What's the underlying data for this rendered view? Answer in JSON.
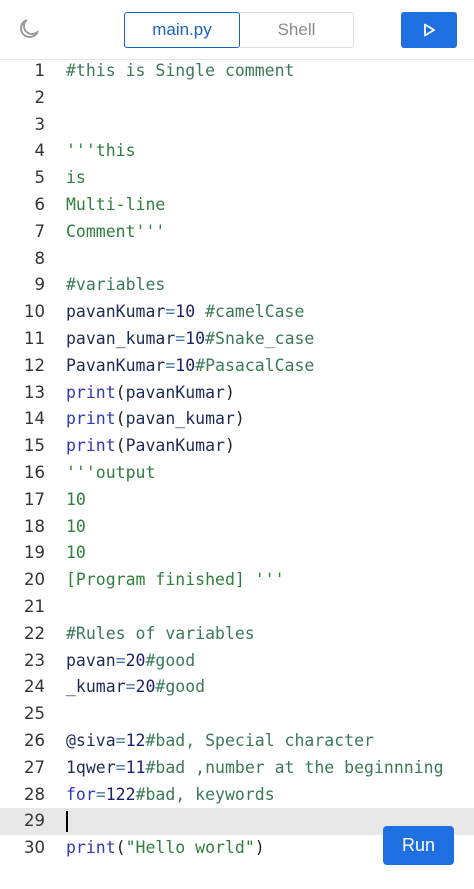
{
  "header": {
    "tab_main": "main.py",
    "tab_shell": "Shell"
  },
  "run_button_label": "Run",
  "icons": {
    "theme": "moon-icon",
    "run": "play-icon"
  },
  "colors": {
    "accent": "#1e6fe0",
    "comment": "#3a7a57",
    "keyword": "#3338b8"
  },
  "editor": {
    "active_line": 29,
    "lines": [
      {
        "n": "1"
      },
      {
        "n": "2"
      },
      {
        "n": "3"
      },
      {
        "n": "4"
      },
      {
        "n": "5"
      },
      {
        "n": "6"
      },
      {
        "n": "7"
      },
      {
        "n": "8"
      },
      {
        "n": "9"
      },
      {
        "n": "10"
      },
      {
        "n": "11"
      },
      {
        "n": "12"
      },
      {
        "n": "13"
      },
      {
        "n": "14"
      },
      {
        "n": "15"
      },
      {
        "n": "16"
      },
      {
        "n": "17"
      },
      {
        "n": "18"
      },
      {
        "n": "19"
      },
      {
        "n": "20"
      },
      {
        "n": "21"
      },
      {
        "n": "22"
      },
      {
        "n": "23"
      },
      {
        "n": "24"
      },
      {
        "n": "25"
      },
      {
        "n": "26"
      },
      {
        "n": "27"
      },
      {
        "n": "28"
      },
      {
        "n": "29"
      },
      {
        "n": "30"
      }
    ],
    "code": {
      "l1": "#this is Single comment",
      "l4": "'''this",
      "l5": "is",
      "l6": "Multi-line",
      "l7": "Comment'''",
      "l9": "#variables",
      "l10a": "pavanKumar",
      "l10b": "=",
      "l10c": "10",
      "l10d": " #camelCase",
      "l11a": "pavan_kumar",
      "l11b": "=",
      "l11c": "10",
      "l11d": "#Snake_case",
      "l12a": "PavanKumar",
      "l12b": "=",
      "l12c": "10",
      "l12d": "#PasacalCase",
      "l13a": "print",
      "l13b": "(",
      "l13c": "pavanKumar",
      "l13d": ")",
      "l14a": "print",
      "l14b": "(",
      "l14c": "pavan_kumar",
      "l14d": ")",
      "l15a": "print",
      "l15b": "(",
      "l15c": "PavanKumar",
      "l15d": ")",
      "l16": "'''output",
      "l17": "10",
      "l18": "10",
      "l19": "10",
      "l20": "[Program finished] '''",
      "l22": "#Rules of variables",
      "l23a": "pavan",
      "l23b": "=",
      "l23c": "20",
      "l23d": "#good",
      "l24a": "_kumar",
      "l24b": "=",
      "l24c": "20",
      "l24d": "#good",
      "l26a": "@siva",
      "l26b": "=",
      "l26c": "12",
      "l26d": "#bad, Special character",
      "l27a": "1qwer",
      "l27b": "=",
      "l27c": "11",
      "l27d": "#bad ,number at the beginnning",
      "l28a": "for",
      "l28b": "=",
      "l28c": "122",
      "l28d": "#bad, keywords",
      "l30a": "print",
      "l30b": "(",
      "l30c": "\"Hello world\"",
      "l30d": ")"
    }
  }
}
